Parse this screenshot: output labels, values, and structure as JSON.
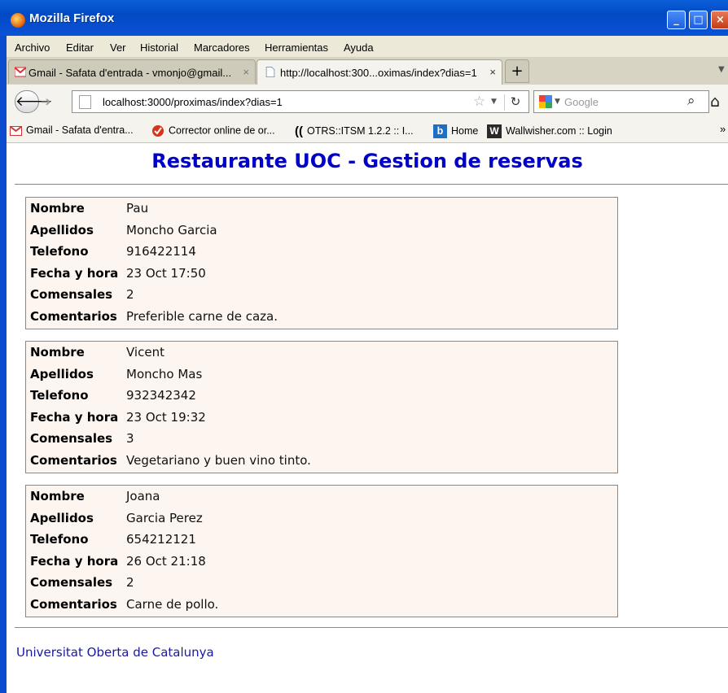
{
  "window": {
    "title": "Mozilla Firefox"
  },
  "menu": [
    "Archivo",
    "Editar",
    "Ver",
    "Historial",
    "Marcadores",
    "Herramientas",
    "Ayuda"
  ],
  "tabs": [
    {
      "label": "Gmail - Safata d'entrada - vmonjo@gmail...",
      "close": "×",
      "active": false
    },
    {
      "label": "http://localhost:300...oximas/index?dias=1",
      "close": "×",
      "active": true
    }
  ],
  "newtab_label": "+",
  "nav": {
    "url": "localhost:3000/proximas/index?dias=1",
    "search_placeholder": "Google"
  },
  "bookmarks": [
    "Gmail - Safata d'entra...",
    "Corrector online de or...",
    "OTRS::ITSM 1.2.2 :: I...",
    "Home",
    "Wallwisher.com :: Login"
  ],
  "bookmarks_more": "»",
  "page": {
    "title": "Restaurante UOC - Gestion de reservas",
    "labels": {
      "nombre": "Nombre",
      "apellidos": "Apellidos",
      "telefono": "Telefono",
      "fecha": "Fecha y hora",
      "comensales": "Comensales",
      "comentarios": "Comentarios"
    },
    "reservas": [
      {
        "nombre": "Pau",
        "apellidos": "Moncho Garcia",
        "telefono": "916422114",
        "fecha": "23 Oct 17:50",
        "comensales": "2",
        "comentarios": "Preferible carne de caza."
      },
      {
        "nombre": "Vicent",
        "apellidos": "Moncho Mas",
        "telefono": "932342342",
        "fecha": "23 Oct 19:32",
        "comensales": "3",
        "comentarios": "Vegetariano y buen vino tinto."
      },
      {
        "nombre": "Joana",
        "apellidos": "Garcia Perez",
        "telefono": "654212121",
        "fecha": "26 Oct 21:18",
        "comensales": "2",
        "comentarios": "Carne de pollo."
      }
    ],
    "footer": "Universitat Oberta de Catalunya"
  },
  "colors": {
    "title": "#0000c8",
    "card_bg": "#fdf5ef",
    "footer_link": "#1a1a99"
  }
}
